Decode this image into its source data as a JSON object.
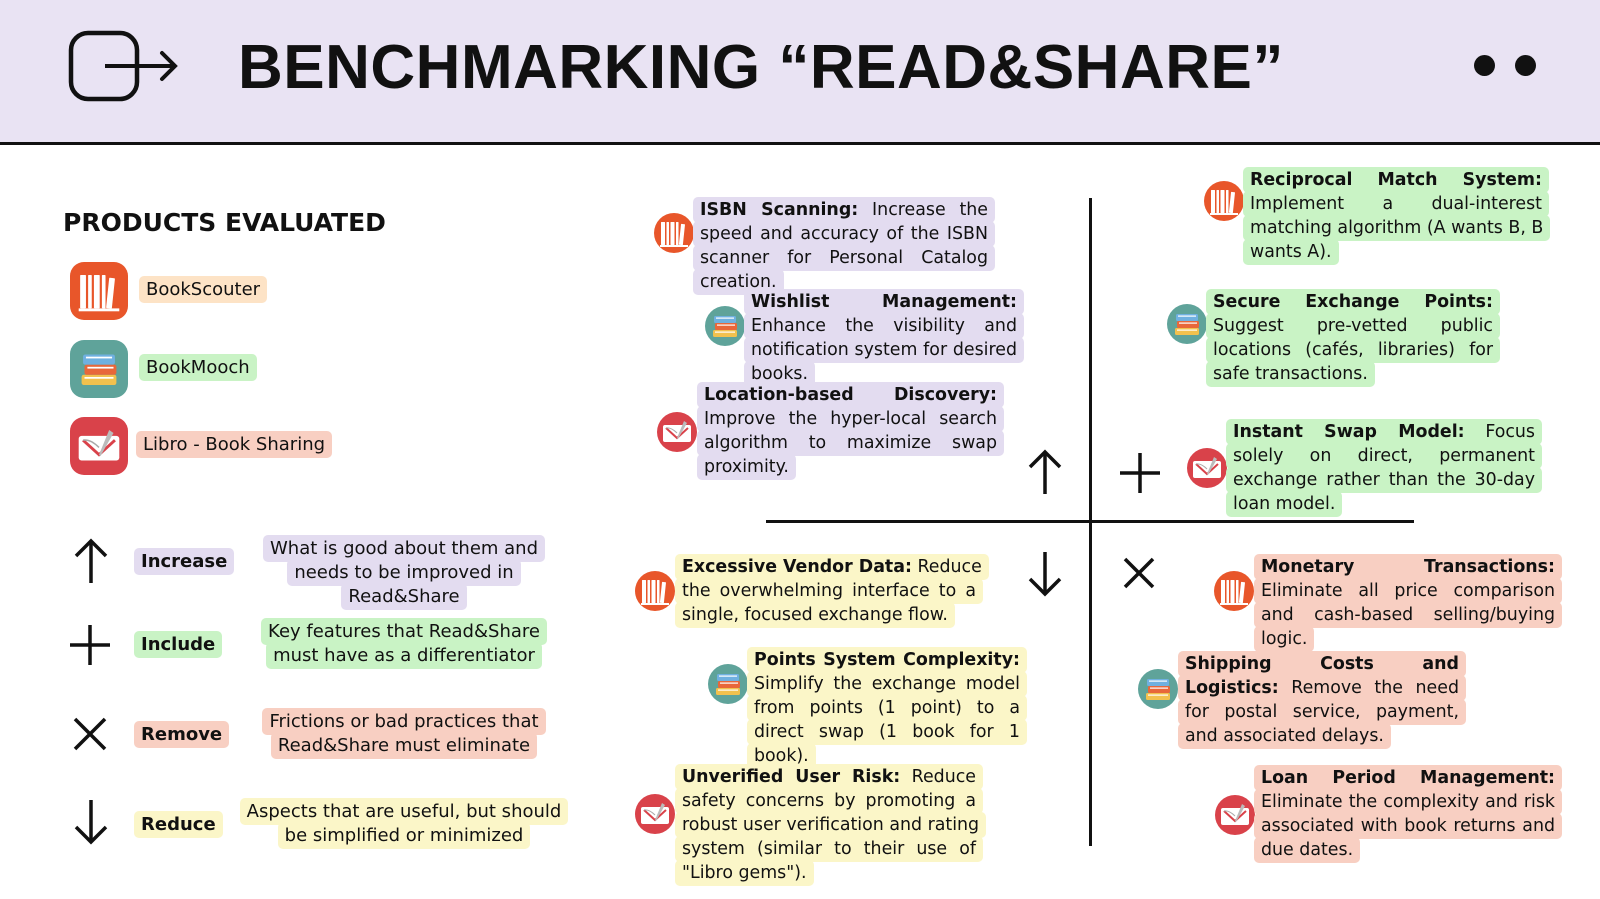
{
  "header": {
    "title": "BENCHMARKING “READ&SHARE”",
    "logo_icon": "exit-arrow-icon",
    "menu_icon": "two-dots-icon",
    "background": "#e9e3f3"
  },
  "products": {
    "title": "PRODUCTS EVALUATED",
    "items": [
      {
        "name": "BookScouter",
        "icon": "bookshelf-icon",
        "color": "#e8562a"
      },
      {
        "name": "BookMooch",
        "icon": "book-stack-icon",
        "color": "#5fa39a"
      },
      {
        "name": "Libro - Book Sharing",
        "icon": "open-book-icon",
        "color": "#d9424a"
      }
    ]
  },
  "legend": [
    {
      "symbol": "arrow-up-icon",
      "key": "Increase",
      "description": "What is good about them and needs to be improved in Read&Share",
      "color": "#e3dcf0"
    },
    {
      "symbol": "plus-icon",
      "key": "Include",
      "description": "Key features that Read&Share must have as a differentiator",
      "color": "#c9f3c5"
    },
    {
      "symbol": "cross-icon",
      "key": "Remove",
      "description": "Frictions or bad practices that Read&Share must eliminate",
      "color": "#f8cfc2"
    },
    {
      "symbol": "arrow-down-icon",
      "key": "Reduce",
      "description": "Aspects that are useful, but should be simplified or minimized",
      "color": "#fbf6c8"
    }
  ],
  "quadrants": {
    "increase": [
      {
        "product": "BookScouter",
        "title": "ISBN Scanning:",
        "text": " Increase the speed and accuracy of the ISBN scanner for Personal Catalog creation."
      },
      {
        "product": "BookMooch",
        "title": "Wishlist Management:",
        "text": " Enhance the visibility and notification system for desired books."
      },
      {
        "product": "Libro - Book Sharing",
        "title": "Location-based Discovery:",
        "text": " Improve the hyper-local search algorithm to maximize swap proximity."
      }
    ],
    "include": [
      {
        "product": "BookScouter",
        "title": "Reciprocal Match System:",
        "text": " Implement a dual-interest matching algorithm (A wants B, B wants A)."
      },
      {
        "product": "BookMooch",
        "title": "Secure Exchange Points:",
        "text": " Suggest pre-vetted public locations (cafés, libraries) for safe transactions."
      },
      {
        "product": "Libro - Book Sharing",
        "title": "Instant Swap Model:",
        "text": " Focus solely on direct, permanent exchange rather than the 30-day loan model."
      }
    ],
    "reduce": [
      {
        "product": "BookScouter",
        "title": "Excessive Vendor Data:",
        "text": " Reduce the overwhelming interface to a single, focused exchange flow."
      },
      {
        "product": "BookMooch",
        "title": "Points System Complexity:",
        "text": " Simplify the exchange model from points (1 point) to a direct swap (1 book for 1 book)."
      },
      {
        "product": "Libro - Book Sharing",
        "title": "Unverified User Risk:",
        "text": " Reduce safety concerns by promoting a robust user verification and rating system (similar to their use of \"Libro gems\")."
      }
    ],
    "remove": [
      {
        "product": "BookScouter",
        "title": "Monetary Transactions:",
        "text": " Eliminate all price comparison and cash-based selling/buying logic."
      },
      {
        "product": "BookMooch",
        "title": "Shipping Costs and Logistics:",
        "text": " Remove the need for postal service, payment, and associated delays."
      },
      {
        "product": "Libro - Book Sharing",
        "title": "Loan Period Management:",
        "text": " Eliminate the complexity and risk associated with book returns and due dates."
      }
    ]
  }
}
